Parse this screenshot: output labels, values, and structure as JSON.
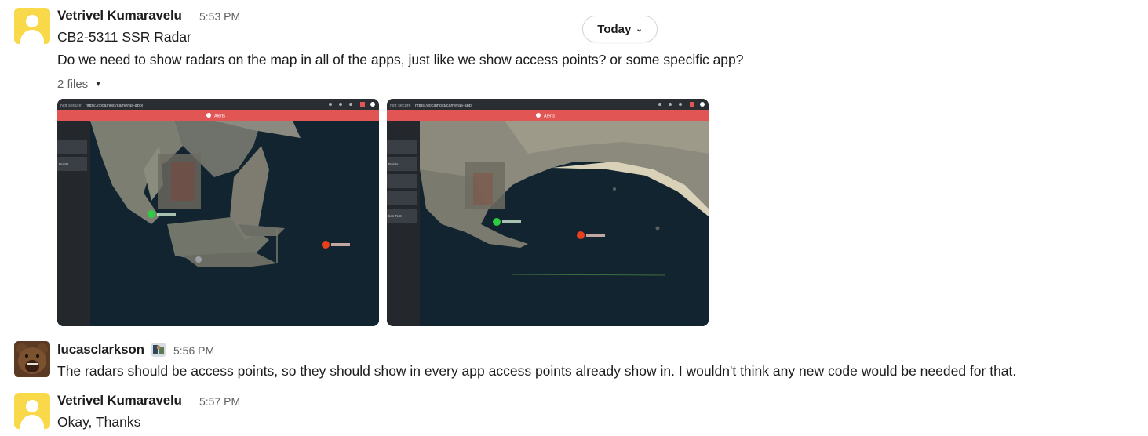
{
  "date_divider": {
    "label": "Today",
    "chevron_icon": "chevron-down-icon"
  },
  "messages": [
    {
      "author": "Vetrivel Kumaravelu",
      "time": "5:53 PM",
      "avatar": "default-user-avatar",
      "lines": [
        "CB2-5311 SSR Radar",
        "Do we need to show radars on the map in all of the apps, just like we show access points? or some specific app?"
      ],
      "files": {
        "label": "2 files",
        "caret_icon": "caret-down-icon",
        "screenshots": [
          {
            "browser_warning": "Not secure",
            "url": "https://localhost/cameras-app/",
            "alert_label": "Alerts",
            "sidebar_items": [
              "",
              "Points"
            ]
          },
          {
            "browser_warning": "Not secure",
            "url": "https://localhost/cameras-app/",
            "alert_label": "Alerts",
            "sidebar_items": [
              "",
              "Points",
              "",
              "",
              "tion Test"
            ]
          }
        ]
      }
    },
    {
      "author": "lucasclarkson",
      "time": "5:56 PM",
      "avatar": "bear-avatar",
      "status_emoji": "custom-status-emoji",
      "lines": [
        "The radars should be access points, so they should show in every app access points already show in. I wouldn't think any new code would be needed for that."
      ]
    },
    {
      "author": "Vetrivel Kumaravelu",
      "time": "5:57 PM",
      "avatar": "default-user-avatar",
      "lines": [
        "Okay, Thanks"
      ]
    }
  ],
  "colors": {
    "text": "#1d1c1d",
    "muted": "#616061",
    "avatar_yellow": "#f9d84a",
    "alert_bar": "#e25555",
    "radar_ok": "#2ecc40",
    "radar_alert": "#e8401c",
    "water": "#122430"
  }
}
